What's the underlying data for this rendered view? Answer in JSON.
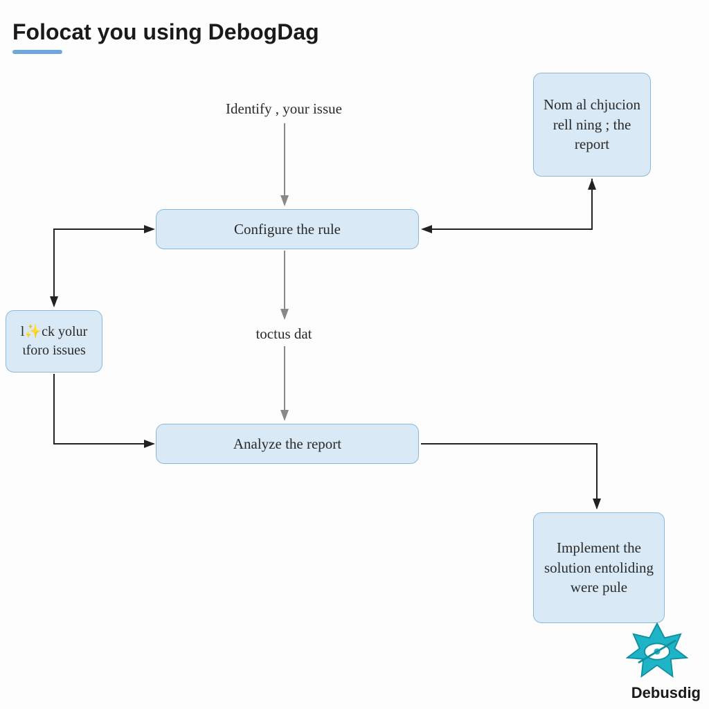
{
  "title": "Folocat you using DebogDag",
  "labels": {
    "identify": "Identify , your issue",
    "toctus": "toctus dat"
  },
  "nodes": {
    "configure": "Configure the rule",
    "analyze": "Analyze the report",
    "check_issues": "l✨ck yolur ɩforo issues",
    "nom_al": "Nom al chjucion rell ning ; the report",
    "implement": "Implement the solution entoliding were pule"
  },
  "brand": "Debusdig"
}
